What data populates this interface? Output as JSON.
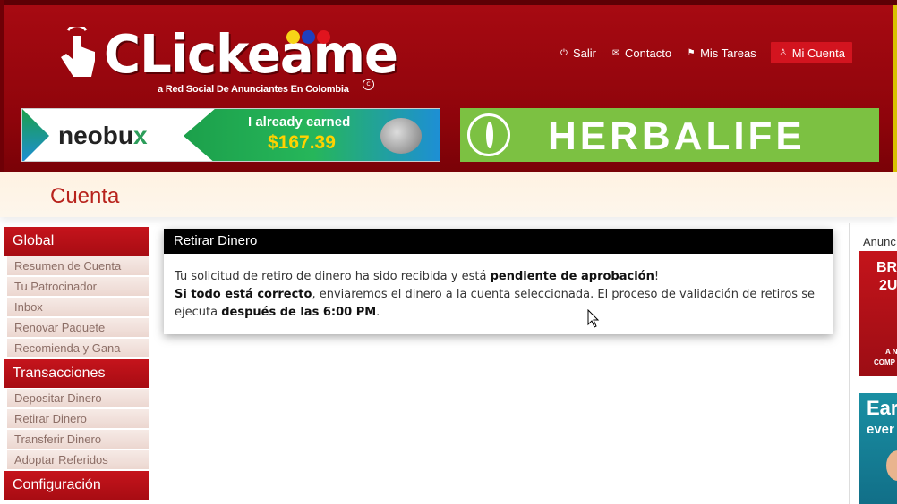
{
  "header": {
    "logo_text": "CLickeame",
    "logo_tagline": "a Red Social De Anunciantes En Colombia",
    "logo_dot_colors": [
      "#f7d417",
      "#1f3fbf",
      "#e0141e"
    ],
    "nav": [
      {
        "label": "Salir",
        "icon": "power-icon"
      },
      {
        "label": "Contacto",
        "icon": "envelope-icon"
      },
      {
        "label": "Mis Tareas",
        "icon": "flag-icon"
      },
      {
        "label": "Mi Cuenta",
        "icon": "user-icon",
        "active": true
      }
    ]
  },
  "banners": {
    "neobux": {
      "logo": "neobu",
      "logo_x": "x",
      "earned_label": "I already earned",
      "amount": "$167.39"
    },
    "herbalife": {
      "text": "HERBALIFE"
    }
  },
  "page": {
    "title": "Cuenta"
  },
  "sidebar": {
    "sections": [
      {
        "title": "Global",
        "items": [
          "Resumen de Cuenta",
          "Tu Patrocinador",
          "Inbox",
          "Renovar Paquete",
          "Recomienda y Gana"
        ]
      },
      {
        "title": "Transacciones",
        "items": [
          "Depositar Dinero",
          "Retirar Dinero",
          "Transferir Dinero",
          "Adoptar Referidos"
        ]
      },
      {
        "title": "Configuración",
        "items": []
      }
    ]
  },
  "main": {
    "panel_title": "Retirar Dinero",
    "line1_pre": "Tu solicitud de retiro de dinero ha sido recibida y está ",
    "line1_bold": "pendiente de aprobación",
    "line1_post": "!",
    "line2_bold": "Si todo está correcto",
    "line2_text": ", enviaremos el dinero a la cuenta seleccionada. El proceso de validación de retiros se ejecuta ",
    "line2_bold2": "después de las 6:00 PM",
    "line2_post": "."
  },
  "right": {
    "title": "Anunc",
    "ad1": {
      "t1": "BRA",
      "t2": "2U",
      "t3": "A N",
      "t4": "COMP"
    },
    "ad2": {
      "t1": "Ear",
      "t2": "ever"
    }
  }
}
